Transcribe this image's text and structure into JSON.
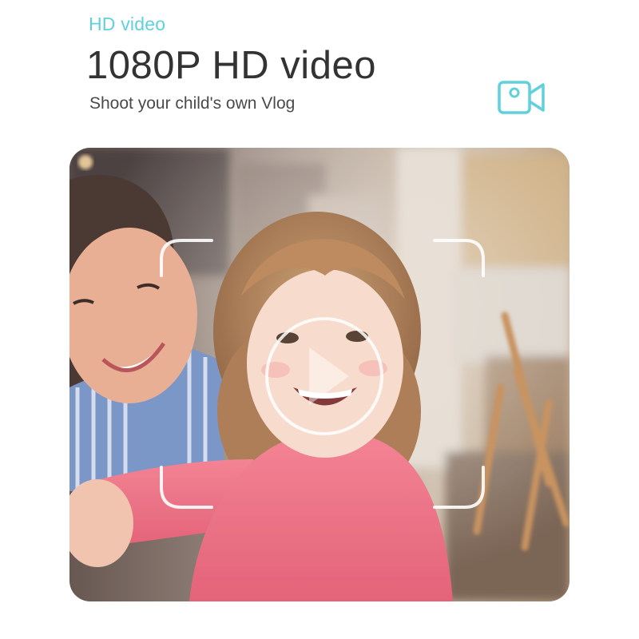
{
  "header": {
    "eyebrow": "HD video",
    "title": "1080P HD video",
    "subtitle": "Shoot your child's own Vlog"
  },
  "icons": {
    "camera": "video-camera-icon",
    "play": "play-icon"
  },
  "colors": {
    "accent": "#5fd0dc",
    "title": "#333333",
    "subtitle": "#4a4a4a",
    "shirt": "#ef6b7e"
  }
}
